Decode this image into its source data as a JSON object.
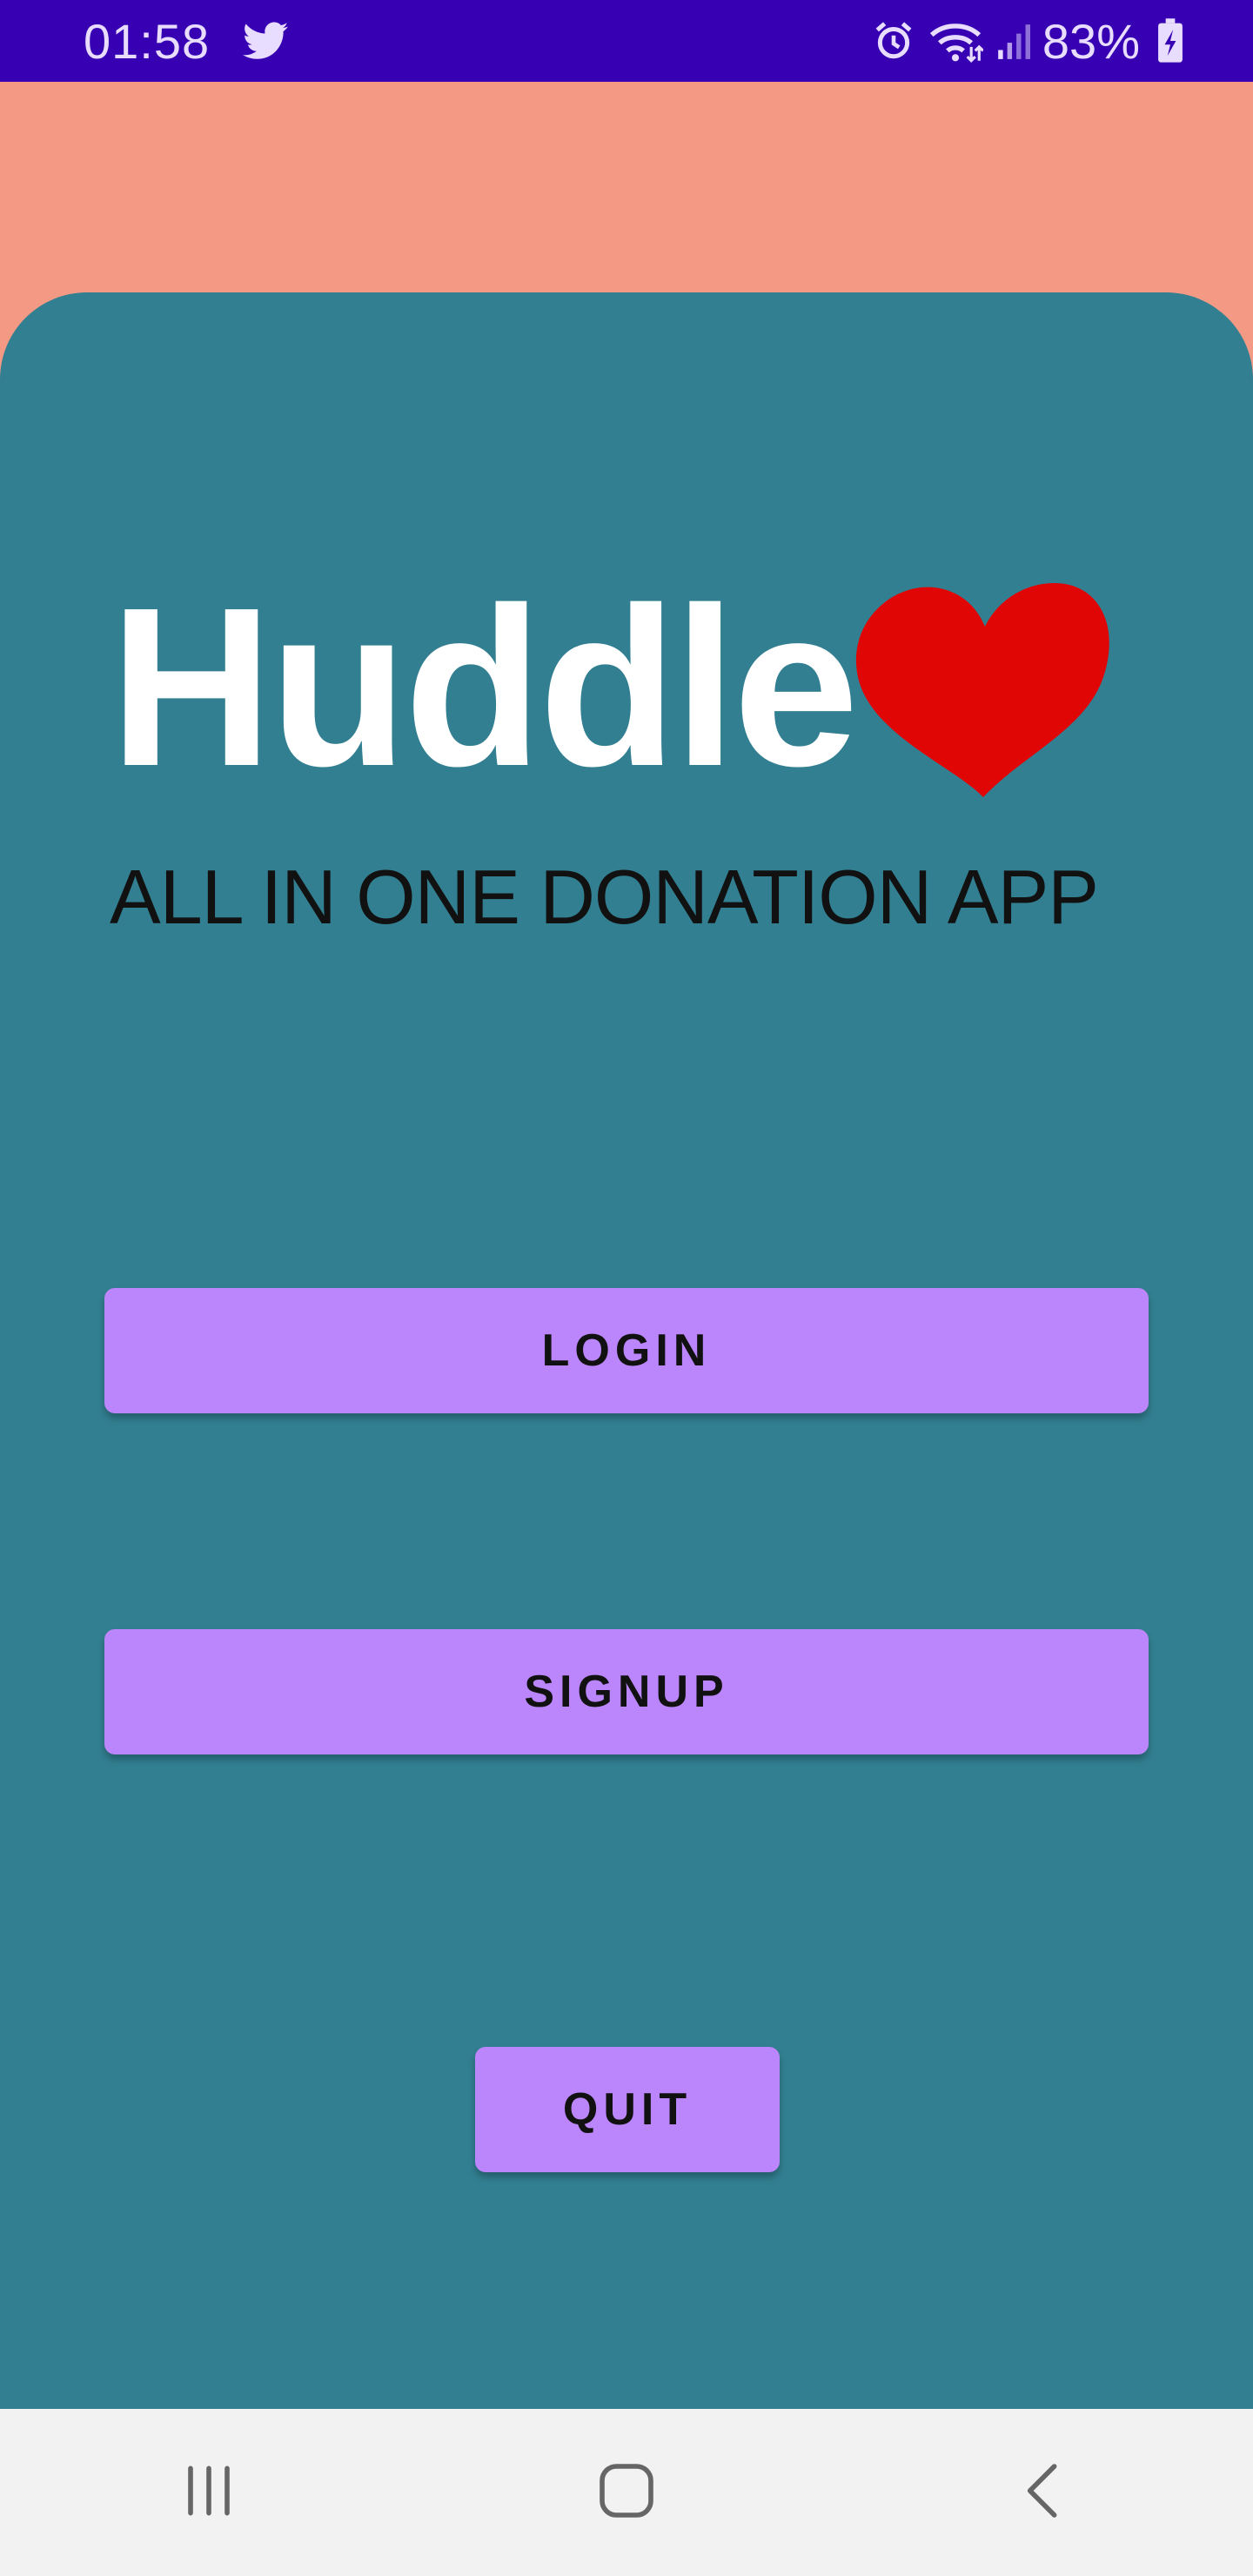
{
  "status_bar": {
    "time": "01:58",
    "battery": "83%",
    "bg_color": "#3700b3"
  },
  "app": {
    "name": "Huddle",
    "tagline": "ALL IN ONE DONATION APP",
    "heart_color": "#e00606",
    "card_color": "#327f91",
    "background_color": "#f49a84"
  },
  "buttons": {
    "login": "LOGIN",
    "signup": "SIGNUP",
    "quit": "QUIT",
    "color": "#bb86fc"
  },
  "nav": {
    "recents": "recents-icon",
    "home": "home-icon",
    "back": "back-icon"
  }
}
